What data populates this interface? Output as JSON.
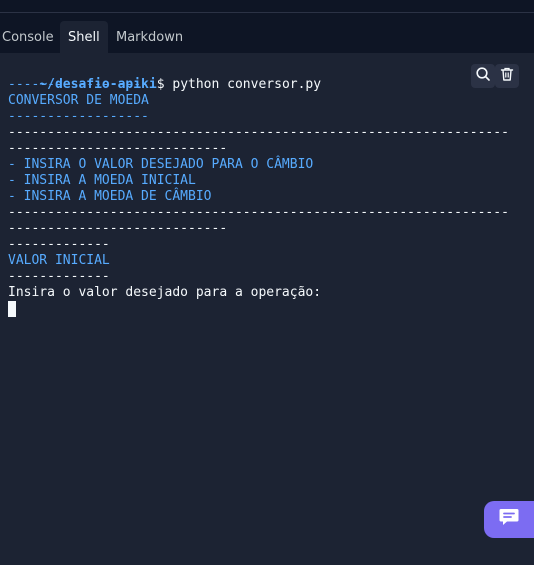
{
  "tabs": [
    {
      "label": "Console",
      "active": false
    },
    {
      "label": "Shell",
      "active": true
    },
    {
      "label": "Markdown",
      "active": false
    }
  ],
  "terminal": {
    "prompt_path": "~/desafio-apiki",
    "prompt_command": "$ python conversor.py",
    "lines": [
      "------------------",
      "CONVERSOR DE MOEDA",
      "------------------",
      "----------------------------------------------------------------",
      "----------------------------",
      "- INSIRA O VALOR DESEJADO PARA O CÂMBIO",
      "- INSIRA A MOEDA INICIAL",
      "- INSIRA A MOEDA DE CÂMBIO",
      "----------------------------------------------------------------",
      "----------------------------",
      "-------------",
      "VALOR INICIAL",
      "-------------",
      "Insira o valor desejado para a operação:"
    ]
  },
  "tools": {
    "search_icon": "search-icon",
    "clear_icon": "trash-icon"
  },
  "chat": {
    "icon": "chat-icon"
  },
  "colors": {
    "background": "#1c2333",
    "tab_bar": "#0e1525",
    "accent_blue": "#57abff",
    "chat_button": "#7c6cf2",
    "text": "#f5f9fc"
  }
}
